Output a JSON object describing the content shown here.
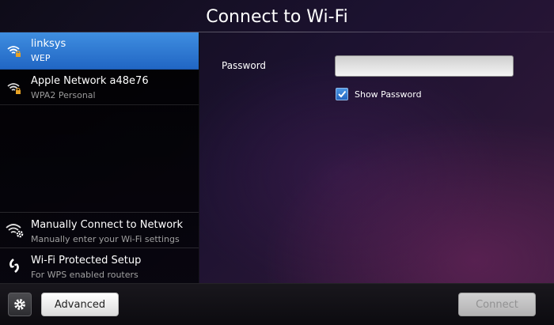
{
  "header": {
    "title": "Connect to Wi-Fi"
  },
  "networks": [
    {
      "name": "linksys",
      "security": "WEP",
      "selected": true,
      "icon": "wifi-locked-icon"
    },
    {
      "name": "Apple Network a48e76",
      "security": "WPA2 Personal",
      "selected": false,
      "icon": "wifi-locked-icon"
    }
  ],
  "manual": {
    "title": "Manually Connect to Network",
    "subtitle": "Manually enter your Wi-Fi settings",
    "icon": "wifi-gear-icon"
  },
  "wps": {
    "title": "Wi-Fi Protected Setup",
    "subtitle": "For WPS enabled routers",
    "icon": "wps-icon"
  },
  "form": {
    "password_label": "Password",
    "password_value": "",
    "show_password_label": "Show Password",
    "show_password_checked": true
  },
  "footer": {
    "settings_icon": "gear-icon",
    "advanced_label": "Advanced",
    "connect_label": "Connect",
    "connect_enabled": false
  },
  "colors": {
    "selection": "#2f7ad6",
    "background": "#1c1230"
  }
}
